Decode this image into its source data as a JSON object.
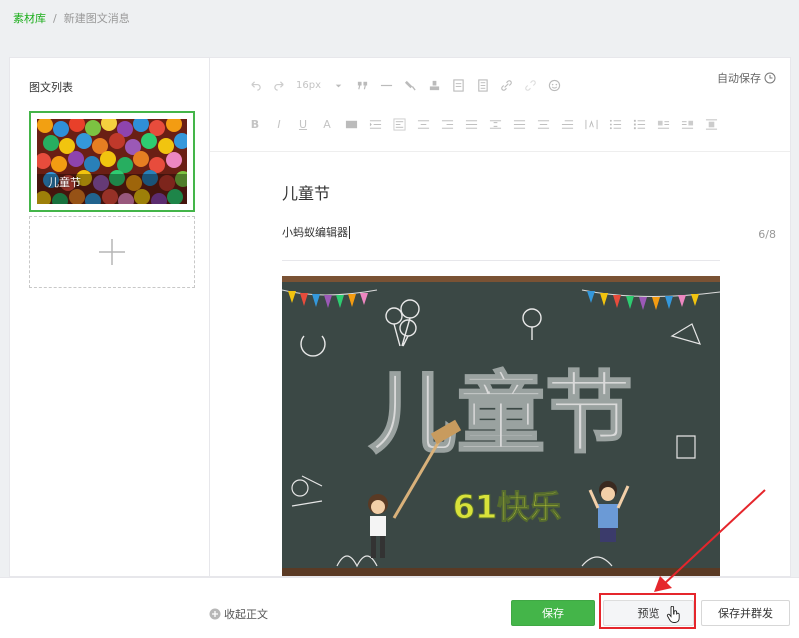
{
  "breadcrumb": {
    "root": "素材库",
    "separator": "/",
    "current": "新建图文消息"
  },
  "sidebar": {
    "title": "图文列表",
    "articles": [
      {
        "title": "儿童节"
      }
    ]
  },
  "toolbar": {
    "font_size": "16px",
    "autosave_label": "自动保存",
    "text_color_icon": "A",
    "bold_icon": "B",
    "italic_icon": "I",
    "underline_icon": "U"
  },
  "editor": {
    "title": "儿童节",
    "author": "小蚂蚁编辑器",
    "author_count": "6/8"
  },
  "cover": {
    "headline": "儿童节",
    "subheadline": "61快乐"
  },
  "footer": {
    "collapse_label": "收起正文",
    "save_label": "保存",
    "preview_label": "预览",
    "send_label": "保存并群发"
  },
  "colors": {
    "brand_green": "#44b549",
    "annotation_red": "#e5262c",
    "chalkboard": "#3c4a47"
  }
}
